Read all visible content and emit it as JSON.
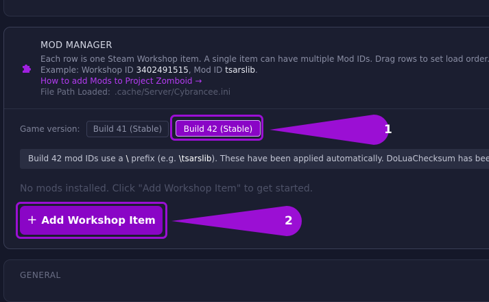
{
  "mod_manager": {
    "title": "MOD MANAGER",
    "description": "Each row is one Steam Workshop item. A single item can have multiple Mod IDs. Drag rows to set load order.",
    "example_prefix": "Example: Workshop ID ",
    "example_workshop_id": "3402491515",
    "example_middle": ", Mod ID ",
    "example_mod_id": "tsarslib",
    "example_suffix": ".",
    "help_link": "How to add Mods to Project Zomboid →",
    "file_path_label": "File Path Loaded:",
    "file_path_value": ".cache/Server/Cybrancee.ini",
    "game_version_label": "Game version:",
    "build41_label": "Build 41 (Stable)",
    "build42_label": "Build 42 (Stable)",
    "banner_part1": "Build 42 mod IDs use a ",
    "banner_backslash": "\\",
    "banner_part2": " prefix (e.g. ",
    "banner_example": "\\tsarslib",
    "banner_part3": "). These have been applied automatically. DoLuaChecksum has been",
    "empty_message": "No mods installed. Click \"Add Workshop Item\" to get started.",
    "add_button_plus": "+",
    "add_button_label": "Add Workshop Item"
  },
  "annotations": {
    "badge1": "1",
    "badge2": "2",
    "color": "#9b0fd4"
  },
  "next_section": {
    "title": "GENERAL"
  }
}
